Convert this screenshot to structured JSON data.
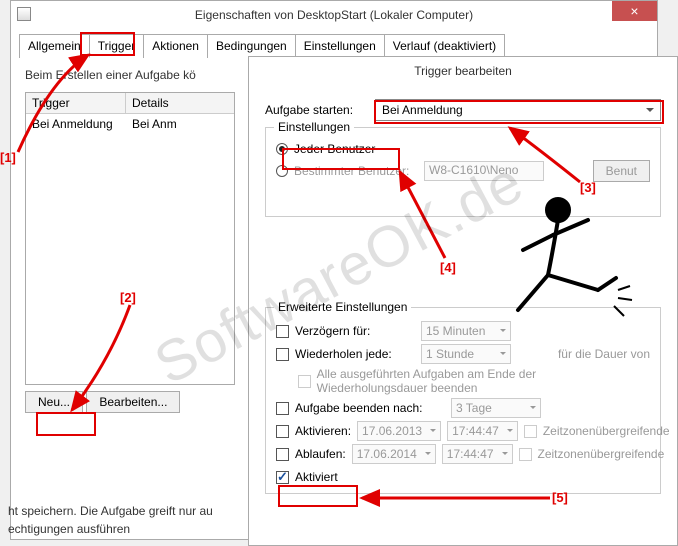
{
  "main_window": {
    "title": "Eigenschaften von DesktopStart (Lokaler Computer)",
    "tabs": [
      "Allgemein",
      "Trigger",
      "Aktionen",
      "Bedingungen",
      "Einstellungen",
      "Verlauf (deaktiviert)"
    ],
    "active_tab_index": 1,
    "hint": "Beim Erstellen einer Aufgabe kö",
    "table": {
      "cols": [
        "Trigger",
        "Details"
      ],
      "row": [
        "Bei Anmeldung",
        "Bei Anm"
      ]
    },
    "buttons": {
      "new": "Neu...",
      "edit": "Bearbeiten..."
    }
  },
  "dialog": {
    "title": "Trigger bearbeiten",
    "start_label": "Aufgabe starten:",
    "start_value": "Bei Anmeldung",
    "settings_group": "Einstellungen",
    "radio_any": "Jeder Benutzer",
    "radio_specific": "Bestimmter Benutzer:",
    "specific_value": "W8-C1610\\Neno",
    "benut_btn": "Benut",
    "adv_group": "Erweiterte Einstellungen",
    "delay_label": "Verzögern für:",
    "delay_value": "15 Minuten",
    "repeat_label": "Wiederholen jede:",
    "repeat_value": "1 Stunde",
    "repeat_tail": "für die Dauer von",
    "repeat_note": "Alle ausgeführten Aufgaben am Ende der Wiederholungsdauer beenden",
    "stop_label": "Aufgabe beenden nach:",
    "stop_value": "3 Tage",
    "activate_label": "Aktivieren:",
    "activate_date": "17.06.2013",
    "activate_time": "17:44:47",
    "expire_label": "Ablaufen:",
    "expire_date": "17.06.2014",
    "expire_time": "17:44:47",
    "tz_label": "Zeitzonenübergreifende",
    "enabled_label": "Aktiviert"
  },
  "footer": {
    "line1": "ht speichern. Die Aufgabe greift nur au",
    "line2": "echtigungen ausführen"
  },
  "annotations": {
    "a1": "[1]",
    "a2": "[2]",
    "a3": "[3]",
    "a4": "[4]",
    "a5": "[5]"
  },
  "watermark": "SoftwareOK.de"
}
